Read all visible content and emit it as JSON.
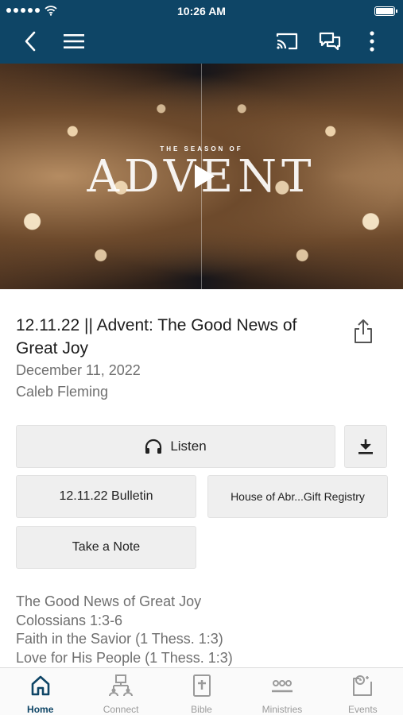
{
  "status_bar": {
    "time": "10:26 AM"
  },
  "nav": {
    "back_icon": "chevron-left-icon",
    "menu_icon": "hamburger-menu-icon",
    "cast_icon": "cast-icon",
    "chat_icon": "chat-bubbles-icon",
    "more_icon": "more-vertical-icon"
  },
  "hero": {
    "season_text": "THE SEASON OF",
    "title_text": "ADVENT",
    "play_icon": "play-icon"
  },
  "sermon": {
    "title": "12.11.22 || Advent: The Good News of Great Joy",
    "date": "December 11, 2022",
    "speaker": "Caleb Fleming",
    "share_icon": "share-icon"
  },
  "actions": {
    "listen_label": "Listen",
    "listen_icon": "headphones-icon",
    "download_icon": "download-icon",
    "bulletin_label": "12.11.22 Bulletin",
    "registry_label": "House of Abr...Gift Registry",
    "note_label": "Take a Note"
  },
  "notes": [
    "The Good News of Great Joy",
    "Colossians 1:3-6",
    "Faith in the Savior (1 Thess. 1:3)",
    "Love for His People (1 Thess. 1:3)"
  ],
  "tabs": [
    {
      "label": "Home",
      "icon": "home-icon",
      "active": true
    },
    {
      "label": "Connect",
      "icon": "connect-icon",
      "active": false
    },
    {
      "label": "Bible",
      "icon": "bible-icon",
      "active": false
    },
    {
      "label": "Ministries",
      "icon": "ministries-icon",
      "active": false
    },
    {
      "label": "Events",
      "icon": "events-icon",
      "active": false
    }
  ],
  "colors": {
    "nav_background": "#0e4566",
    "active_tab": "#0e4566",
    "button_background": "#efefef"
  }
}
